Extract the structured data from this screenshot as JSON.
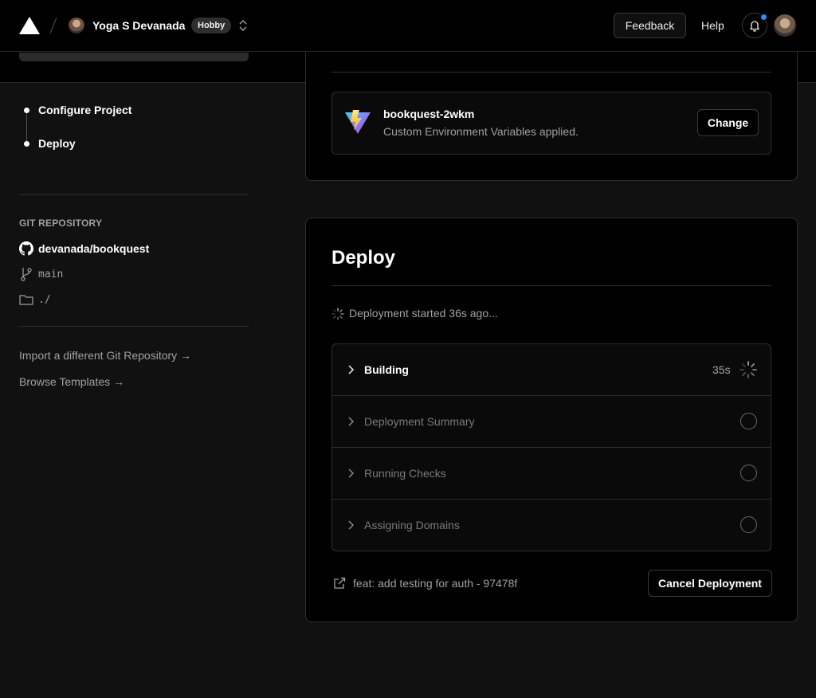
{
  "nav": {
    "user_name": "Yoga S Devanada",
    "plan_badge": "Hobby",
    "feedback_label": "Feedback",
    "help_label": "Help",
    "notification_dot_color": "#2f8cff"
  },
  "sidebar": {
    "steps": [
      {
        "label": "Configure Project"
      },
      {
        "label": "Deploy"
      }
    ],
    "git_heading": "GIT REPOSITORY",
    "repo": "devanada/bookquest",
    "branch": "main",
    "root_dir": "./",
    "links": [
      {
        "label": "Import a different Git Repository →"
      },
      {
        "label": "Browse Templates →"
      }
    ]
  },
  "environment": {
    "title": "bookquest-2wkm",
    "subtitle": "Custom Environment Variables applied.",
    "change_label": "Change"
  },
  "deploy": {
    "title": "Deploy",
    "status": "Deployment started 36s ago...",
    "steps": [
      {
        "label": "Building",
        "time": "35s",
        "state": "running"
      },
      {
        "label": "Deployment Summary",
        "state": "pending"
      },
      {
        "label": "Running Checks",
        "state": "pending"
      },
      {
        "label": "Assigning Domains",
        "state": "pending"
      }
    ],
    "commit": "feat: add testing for auth - 97478f",
    "cancel_label": "Cancel Deployment"
  }
}
